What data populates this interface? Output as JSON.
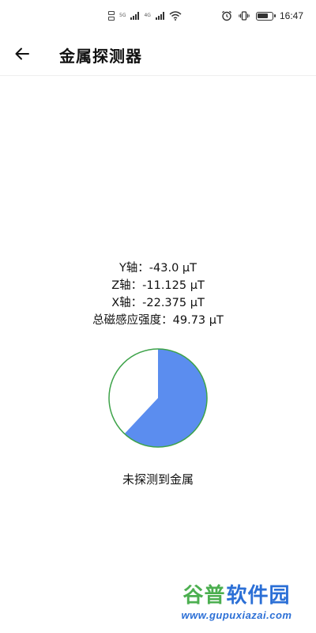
{
  "status_bar": {
    "sim1_label": "5G",
    "sim2_label": "4G",
    "time": "16:47",
    "battery_level": 0.8
  },
  "app_bar": {
    "title": "金属探测器",
    "back_icon": "arrow-left-icon"
  },
  "readings": {
    "y_axis": "Y轴：-43.0 μT",
    "z_axis": "Z轴：-11.125 μT",
    "x_axis": "X轴：-22.375 μT",
    "total": "总磁感应强度：49.73 μT"
  },
  "gauge": {
    "fraction": 0.62,
    "fill_color": "#5b8def",
    "stroke_color": "#3ea34a"
  },
  "detection_status": "未探测到金属",
  "watermark": {
    "brand_part1": "谷普",
    "brand_part2": "软件园",
    "url": "www.gupuxiazai.com"
  }
}
